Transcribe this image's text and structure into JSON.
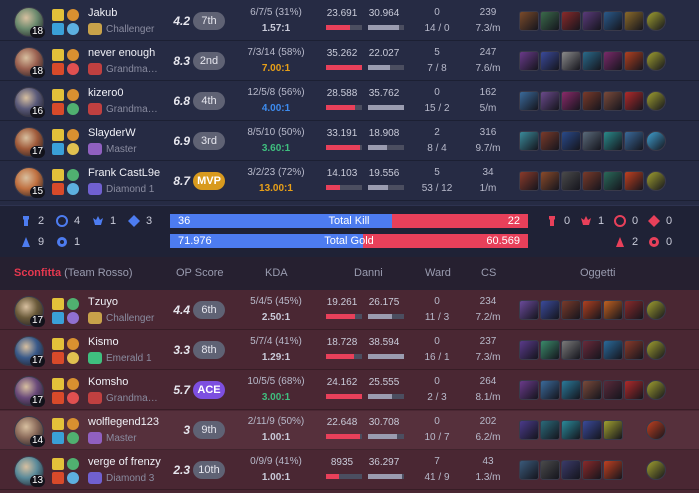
{
  "colors": {
    "blue_accent": "#4d7cf0",
    "red_accent": "#e8405a",
    "kda_default": "#c9cbd9",
    "kda_blue": "#3d8cf0",
    "kda_green": "#3fbf7f",
    "kda_orange": "#e8a018"
  },
  "blue_team": {
    "players": [
      {
        "name": "Jakub",
        "level": "18",
        "rank": "Challenger",
        "rank_color": "#c8a24a",
        "op_score": "4.2",
        "badge": "7th",
        "badge_type": "normal",
        "kda_line": "6/7/5 (31%)",
        "kda_ratio": "1.57:1",
        "kda_color": "default",
        "damage": "23.691",
        "taken": "30.964",
        "damage_frac": 0.67,
        "taken_frac": 0.86,
        "ward": "0",
        "ward_detail": "14 / 0",
        "cs": "239",
        "cs_min": "7.3/m",
        "champ_color": "#6b8a6e",
        "spells": [
          "#e3c13a",
          "#3aa0d8"
        ],
        "runes": [
          "#d89030",
          "#5db0e0"
        ],
        "items": [
          "#7a4a2a",
          "#3a6a4a",
          "#8a2a2a",
          "#5a3a7a",
          "#2a5a8a",
          "#8a6a2a",
          "#a0a030"
        ]
      },
      {
        "name": "never enough",
        "level": "18",
        "rank": "Grandmaster",
        "rank_color": "#c04040",
        "op_score": "8.3",
        "badge": "2nd",
        "badge_type": "normal",
        "kda_line": "7/3/14 (58%)",
        "kda_ratio": "7.00:1",
        "kda_color": "orange",
        "damage": "35.262",
        "taken": "22.027",
        "damage_frac": 1.0,
        "taken_frac": 0.6,
        "ward": "5",
        "ward_detail": "7 / 8",
        "cs": "247",
        "cs_min": "7.6/m",
        "champ_color": "#9a6050",
        "spells": [
          "#e3c13a",
          "#d84a2a"
        ],
        "runes": [
          "#d89030",
          "#e05050"
        ],
        "items": [
          "#6a3a8a",
          "#3a4a9a",
          "#8a8a8a",
          "#2a6a8a",
          "#7a2a6a",
          "#b04020",
          "#a0a030"
        ]
      },
      {
        "name": "kizero0",
        "level": "16",
        "rank": "Grandmaster",
        "rank_color": "#c04040",
        "op_score": "6.8",
        "badge": "4th",
        "badge_type": "normal",
        "kda_line": "12/5/8 (56%)",
        "kda_ratio": "4.00:1",
        "kda_color": "blue",
        "damage": "28.588",
        "taken": "35.762",
        "damage_frac": 0.81,
        "taken_frac": 1.0,
        "ward": "0",
        "ward_detail": "15 / 2",
        "cs": "162",
        "cs_min": "5/m",
        "champ_color": "#5a5a7a",
        "spells": [
          "#e3c13a",
          "#d84a2a"
        ],
        "runes": [
          "#d89030",
          "#50b070"
        ],
        "items": [
          "#3a6a9a",
          "#6a4a8a",
          "#8a2a6a",
          "#7a3a2a",
          "#7a4a3a",
          "#b02a2a",
          "#a0a030"
        ]
      },
      {
        "name": "SlayderW",
        "level": "17",
        "rank": "Master",
        "rank_color": "#9060c0",
        "op_score": "6.9",
        "badge": "3rd",
        "badge_type": "normal",
        "kda_line": "8/5/10 (50%)",
        "kda_ratio": "3.60:1",
        "kda_color": "green",
        "damage": "33.191",
        "taken": "18.908",
        "damage_frac": 0.94,
        "taken_frac": 0.53,
        "ward": "2",
        "ward_detail": "8 / 4",
        "cs": "316",
        "cs_min": "9.7/m",
        "champ_color": "#a05a3a",
        "spells": [
          "#e3c13a",
          "#3aa0d8"
        ],
        "runes": [
          "#d89030",
          "#e0c050"
        ],
        "items": [
          "#3a8a9a",
          "#7a3a2a",
          "#2a4a8a",
          "#5a6a7a",
          "#2a8a8a",
          "#3a6a9a",
          "#40a0d0"
        ]
      },
      {
        "name": "Frank CastL9e",
        "level": "15",
        "rank": "Diamond 1",
        "rank_color": "#7060d0",
        "op_score": "8.7",
        "badge": "MVP",
        "badge_type": "mvp",
        "kda_line": "3/2/23 (72%)",
        "kda_ratio": "13.00:1",
        "kda_color": "orange",
        "damage": "14.103",
        "taken": "19.556",
        "damage_frac": 0.4,
        "taken_frac": 0.55,
        "ward": "5",
        "ward_detail": "53 / 12",
        "cs": "34",
        "cs_min": "1/m",
        "champ_color": "#c07040",
        "spells": [
          "#e3c13a",
          "#d84a2a"
        ],
        "runes": [
          "#50b070",
          "#5db0e0"
        ],
        "items": [
          "#8a3a2a",
          "#8a4a2a",
          "#4a4a4a",
          "#7a3a2a",
          "#2a6a5a",
          "#c04020",
          "#a0a030"
        ]
      }
    ],
    "objectives": {
      "towers": "2",
      "inhib": "4",
      "dragon": "1",
      "herald": "3",
      "baron": "9",
      "rift": "1"
    },
    "total_kill": "36",
    "total_gold": "71.976"
  },
  "red_team": {
    "team_name": "Sconfitta",
    "team_label": "(Team Rosso)",
    "headers": {
      "op_score": "OP Score",
      "kda": "KDA",
      "damage": "Danni",
      "ward": "Ward",
      "cs": "CS",
      "items": "Oggetti"
    },
    "players": [
      {
        "name": "Tzuyo",
        "level": "17",
        "rank": "Challenger",
        "rank_color": "#c8a24a",
        "op_score": "4.4",
        "badge": "6th",
        "badge_type": "normal",
        "kda_line": "5/4/5 (45%)",
        "kda_ratio": "2.50:1",
        "kda_color": "default",
        "damage": "19.261",
        "taken": "26.175",
        "damage_frac": 0.8,
        "taken_frac": 0.68,
        "ward": "0",
        "ward_detail": "11 / 3",
        "cs": "234",
        "cs_min": "7.2/m",
        "champ_color": "#6a5a3a",
        "spells": [
          "#e3c13a",
          "#3aa0d8"
        ],
        "runes": [
          "#50b070",
          "#9070d0"
        ],
        "items": [
          "#6a4a9a",
          "#3a4a9a",
          "#7a3a2a",
          "#b04020",
          "#c06020",
          "#8a2a2a",
          "#a0a030"
        ]
      },
      {
        "name": "Kismo",
        "level": "17",
        "rank": "Emerald 1",
        "rank_color": "#3fbf7f",
        "op_score": "3.3",
        "badge": "8th",
        "badge_type": "normal",
        "kda_line": "5/7/4 (41%)",
        "kda_ratio": "1.29:1",
        "kda_color": "default",
        "damage": "18.728",
        "taken": "38.594",
        "damage_frac": 0.78,
        "taken_frac": 1.0,
        "ward": "0",
        "ward_detail": "16 / 1",
        "cs": "237",
        "cs_min": "7.3/m",
        "champ_color": "#3a5a8a",
        "spells": [
          "#e3c13a",
          "#d84a2a"
        ],
        "runes": [
          "#d89030",
          "#e0c050"
        ],
        "items": [
          "#5a3a8a",
          "#3a8a6a",
          "#7a7a7a",
          "#6a2a3a",
          "#2a6a9a",
          "#8a3a2a",
          "#a0a030"
        ]
      },
      {
        "name": "Komsho",
        "level": "17",
        "rank": "Grandmaster",
        "rank_color": "#c04040",
        "op_score": "5.7",
        "badge": "ACE",
        "badge_type": "ace",
        "kda_line": "10/5/5 (68%)",
        "kda_ratio": "3.00:1",
        "kda_color": "green",
        "damage": "24.162",
        "taken": "25.555",
        "damage_frac": 1.0,
        "taken_frac": 0.66,
        "ward": "0",
        "ward_detail": "2 / 3",
        "cs": "264",
        "cs_min": "8.1/m",
        "champ_color": "#6a4a7a",
        "spells": [
          "#e3c13a",
          "#d84a2a"
        ],
        "runes": [
          "#d89030",
          "#e05050"
        ],
        "items": [
          "#6a3a8a",
          "#3a6a9a",
          "#2a7a9a",
          "#7a4a3a",
          "#5a2a3a",
          "#b02a2a",
          "#a0a030"
        ]
      },
      {
        "name": "wolflegend123",
        "level": "14",
        "rank": "Master",
        "rank_color": "#9060c0",
        "op_score": "3",
        "badge": "9th",
        "badge_type": "normal",
        "kda_line": "2/11/9 (50%)",
        "kda_ratio": "1.00:1",
        "kda_color": "default",
        "damage": "22.648",
        "taken": "30.708",
        "damage_frac": 0.94,
        "taken_frac": 0.8,
        "ward": "0",
        "ward_detail": "10 / 7",
        "cs": "202",
        "cs_min": "6.2/m",
        "champ_color": "#8a6a5a",
        "spells": [
          "#e3c13a",
          "#3aa0d8"
        ],
        "runes": [
          "#d89030",
          "#50b070"
        ],
        "items": [
          "#4a3a8a",
          "#2a6a7a",
          "#2a8a9a",
          "#3a4a9a",
          "#a0a030",
          "#c04020"
        ]
      },
      {
        "name": "verge of frenzy",
        "level": "13",
        "rank": "Diamond 3",
        "rank_color": "#7060d0",
        "op_score": "2.3",
        "badge": "10th",
        "badge_type": "normal",
        "kda_line": "0/9/9 (41%)",
        "kda_ratio": "1.00:1",
        "kda_color": "default",
        "damage": "8935",
        "taken": "36.297",
        "damage_frac": 0.37,
        "taken_frac": 0.94,
        "ward": "7",
        "ward_detail": "41 / 9",
        "cs": "43",
        "cs_min": "1.3/m",
        "champ_color": "#5a8a9a",
        "spells": [
          "#e3c13a",
          "#d84a2a"
        ],
        "runes": [
          "#50b070",
          "#5db0e0"
        ],
        "items": [
          "#3a5a7a",
          "#4a4a4a",
          "#3a3a6a",
          "#8a2a2a",
          "#c04020",
          "#a0a030"
        ]
      }
    ],
    "objectives": {
      "towers": "0",
      "inhib": "1",
      "dragon": "0",
      "herald": "0",
      "baron": "2",
      "rift": "0"
    },
    "total_kill": "22",
    "total_gold": "60.569"
  },
  "totals": {
    "kill_label": "Total Kill",
    "gold_label": "Total Gold",
    "kill_blue_frac": 0.62,
    "gold_blue_frac": 0.54
  }
}
